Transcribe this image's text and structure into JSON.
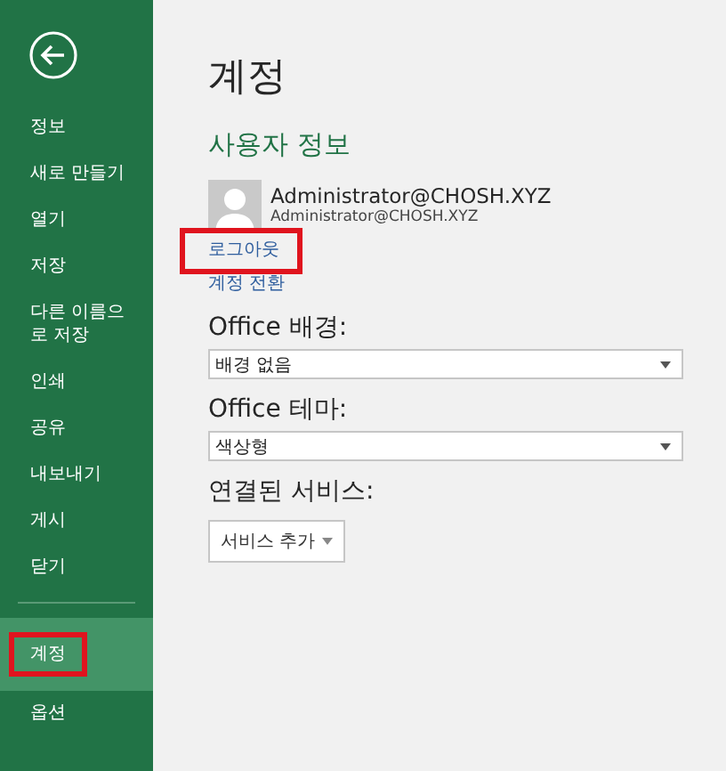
{
  "sidebar": {
    "items": [
      {
        "label": "정보",
        "selected": false,
        "highlighted": false
      },
      {
        "label": "새로 만들기",
        "selected": false,
        "highlighted": false
      },
      {
        "label": "열기",
        "selected": false,
        "highlighted": false
      },
      {
        "label": "저장",
        "selected": false,
        "highlighted": false
      },
      {
        "label": "다른 이름으로 저장",
        "selected": false,
        "highlighted": false
      },
      {
        "label": "인쇄",
        "selected": false,
        "highlighted": false
      },
      {
        "label": "공유",
        "selected": false,
        "highlighted": false
      },
      {
        "label": "내보내기",
        "selected": false,
        "highlighted": false
      },
      {
        "label": "게시",
        "selected": false,
        "highlighted": false
      },
      {
        "label": "닫기",
        "selected": false,
        "highlighted": false
      },
      {
        "kind": "divider"
      },
      {
        "label": "계정",
        "selected": true,
        "highlighted": true
      },
      {
        "label": "옵션",
        "selected": false,
        "highlighted": false
      }
    ]
  },
  "main": {
    "title": "계정",
    "user_info": {
      "heading": "사용자 정보",
      "name": "Administrator@CHOSH.XYZ",
      "email": "Administrator@CHOSH.XYZ",
      "links": [
        {
          "label": "로그아웃",
          "highlighted": true
        },
        {
          "label": "계정 전환",
          "highlighted": false
        }
      ]
    },
    "settings": [
      {
        "label": "Office 배경:",
        "value": "배경 없음"
      },
      {
        "label": "Office 테마:",
        "value": "색상형"
      }
    ],
    "connected_services": {
      "heading": "연결된 서비스:",
      "button": "서비스 추가"
    }
  }
}
